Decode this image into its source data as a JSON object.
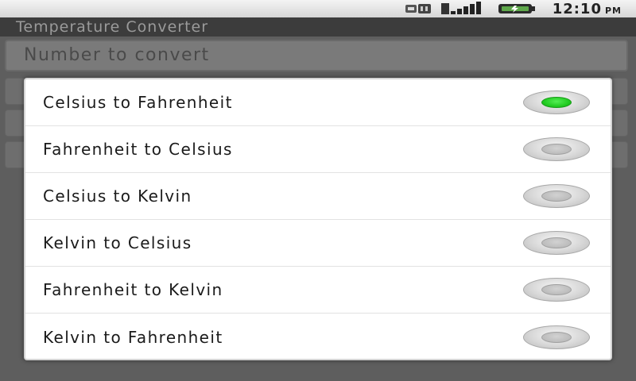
{
  "status_bar": {
    "icons": [
      "usb-icon",
      "signal-icon",
      "battery-icon"
    ],
    "time": "12:10",
    "ampm": "PM"
  },
  "app": {
    "title": "Temperature Converter",
    "input_placeholder": "Number to convert"
  },
  "dialog": {
    "options": [
      {
        "label": "Celsius to Fahrenheit",
        "selected": true
      },
      {
        "label": "Fahrenheit to Celsius",
        "selected": false
      },
      {
        "label": "Celsius to Kelvin",
        "selected": false
      },
      {
        "label": "Kelvin to Celsius",
        "selected": false
      },
      {
        "label": "Fahrenheit to Kelvin",
        "selected": false
      },
      {
        "label": "Kelvin to Fahrenheit",
        "selected": false
      }
    ]
  },
  "colors": {
    "selected_radio": "#22cc22",
    "dialog_background": "#ffffff",
    "app_background": "#5e5e5e"
  }
}
